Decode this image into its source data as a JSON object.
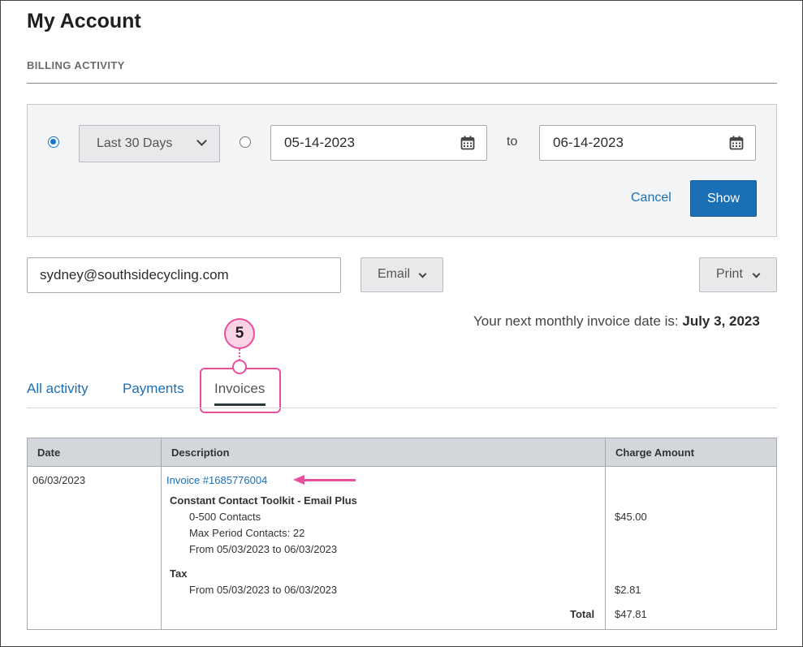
{
  "page": {
    "title": "My Account",
    "section_label": "BILLING ACTIVITY"
  },
  "filter": {
    "range_option": "Last 30 Days",
    "start_date": "05-14-2023",
    "to_label": "to",
    "end_date": "06-14-2023",
    "cancel_label": "Cancel",
    "show_label": "Show"
  },
  "actions": {
    "email_address": "sydney@southsidecycling.com",
    "email_button": "Email",
    "print_button": "Print"
  },
  "notice": {
    "prefix": "Your next monthly invoice date is:",
    "date": "July 3, 2023"
  },
  "callout": {
    "step": "5",
    "color": "#e8509c"
  },
  "tabs": [
    {
      "label": "All activity"
    },
    {
      "label": "Payments"
    },
    {
      "label": "Invoices",
      "active": true
    }
  ],
  "table": {
    "headers": [
      "Date",
      "Description",
      "Charge Amount"
    ],
    "row": {
      "date": "06/03/2023",
      "invoice_link": "Invoice #1685776004",
      "product": "Constant Contact Toolkit - Email Plus",
      "product_lines": [
        "0-500 Contacts",
        "Max Period Contacts: 22",
        "From 05/03/2023 to 06/03/2023"
      ],
      "product_amount": "$45.00",
      "tax_label": "Tax",
      "tax_line": "From 05/03/2023 to 06/03/2023",
      "tax_amount": "$2.81",
      "total_label": "Total",
      "total_amount": "$47.81"
    }
  },
  "colors": {
    "accent": "#1a6fb5",
    "highlight": "#e8509c"
  }
}
